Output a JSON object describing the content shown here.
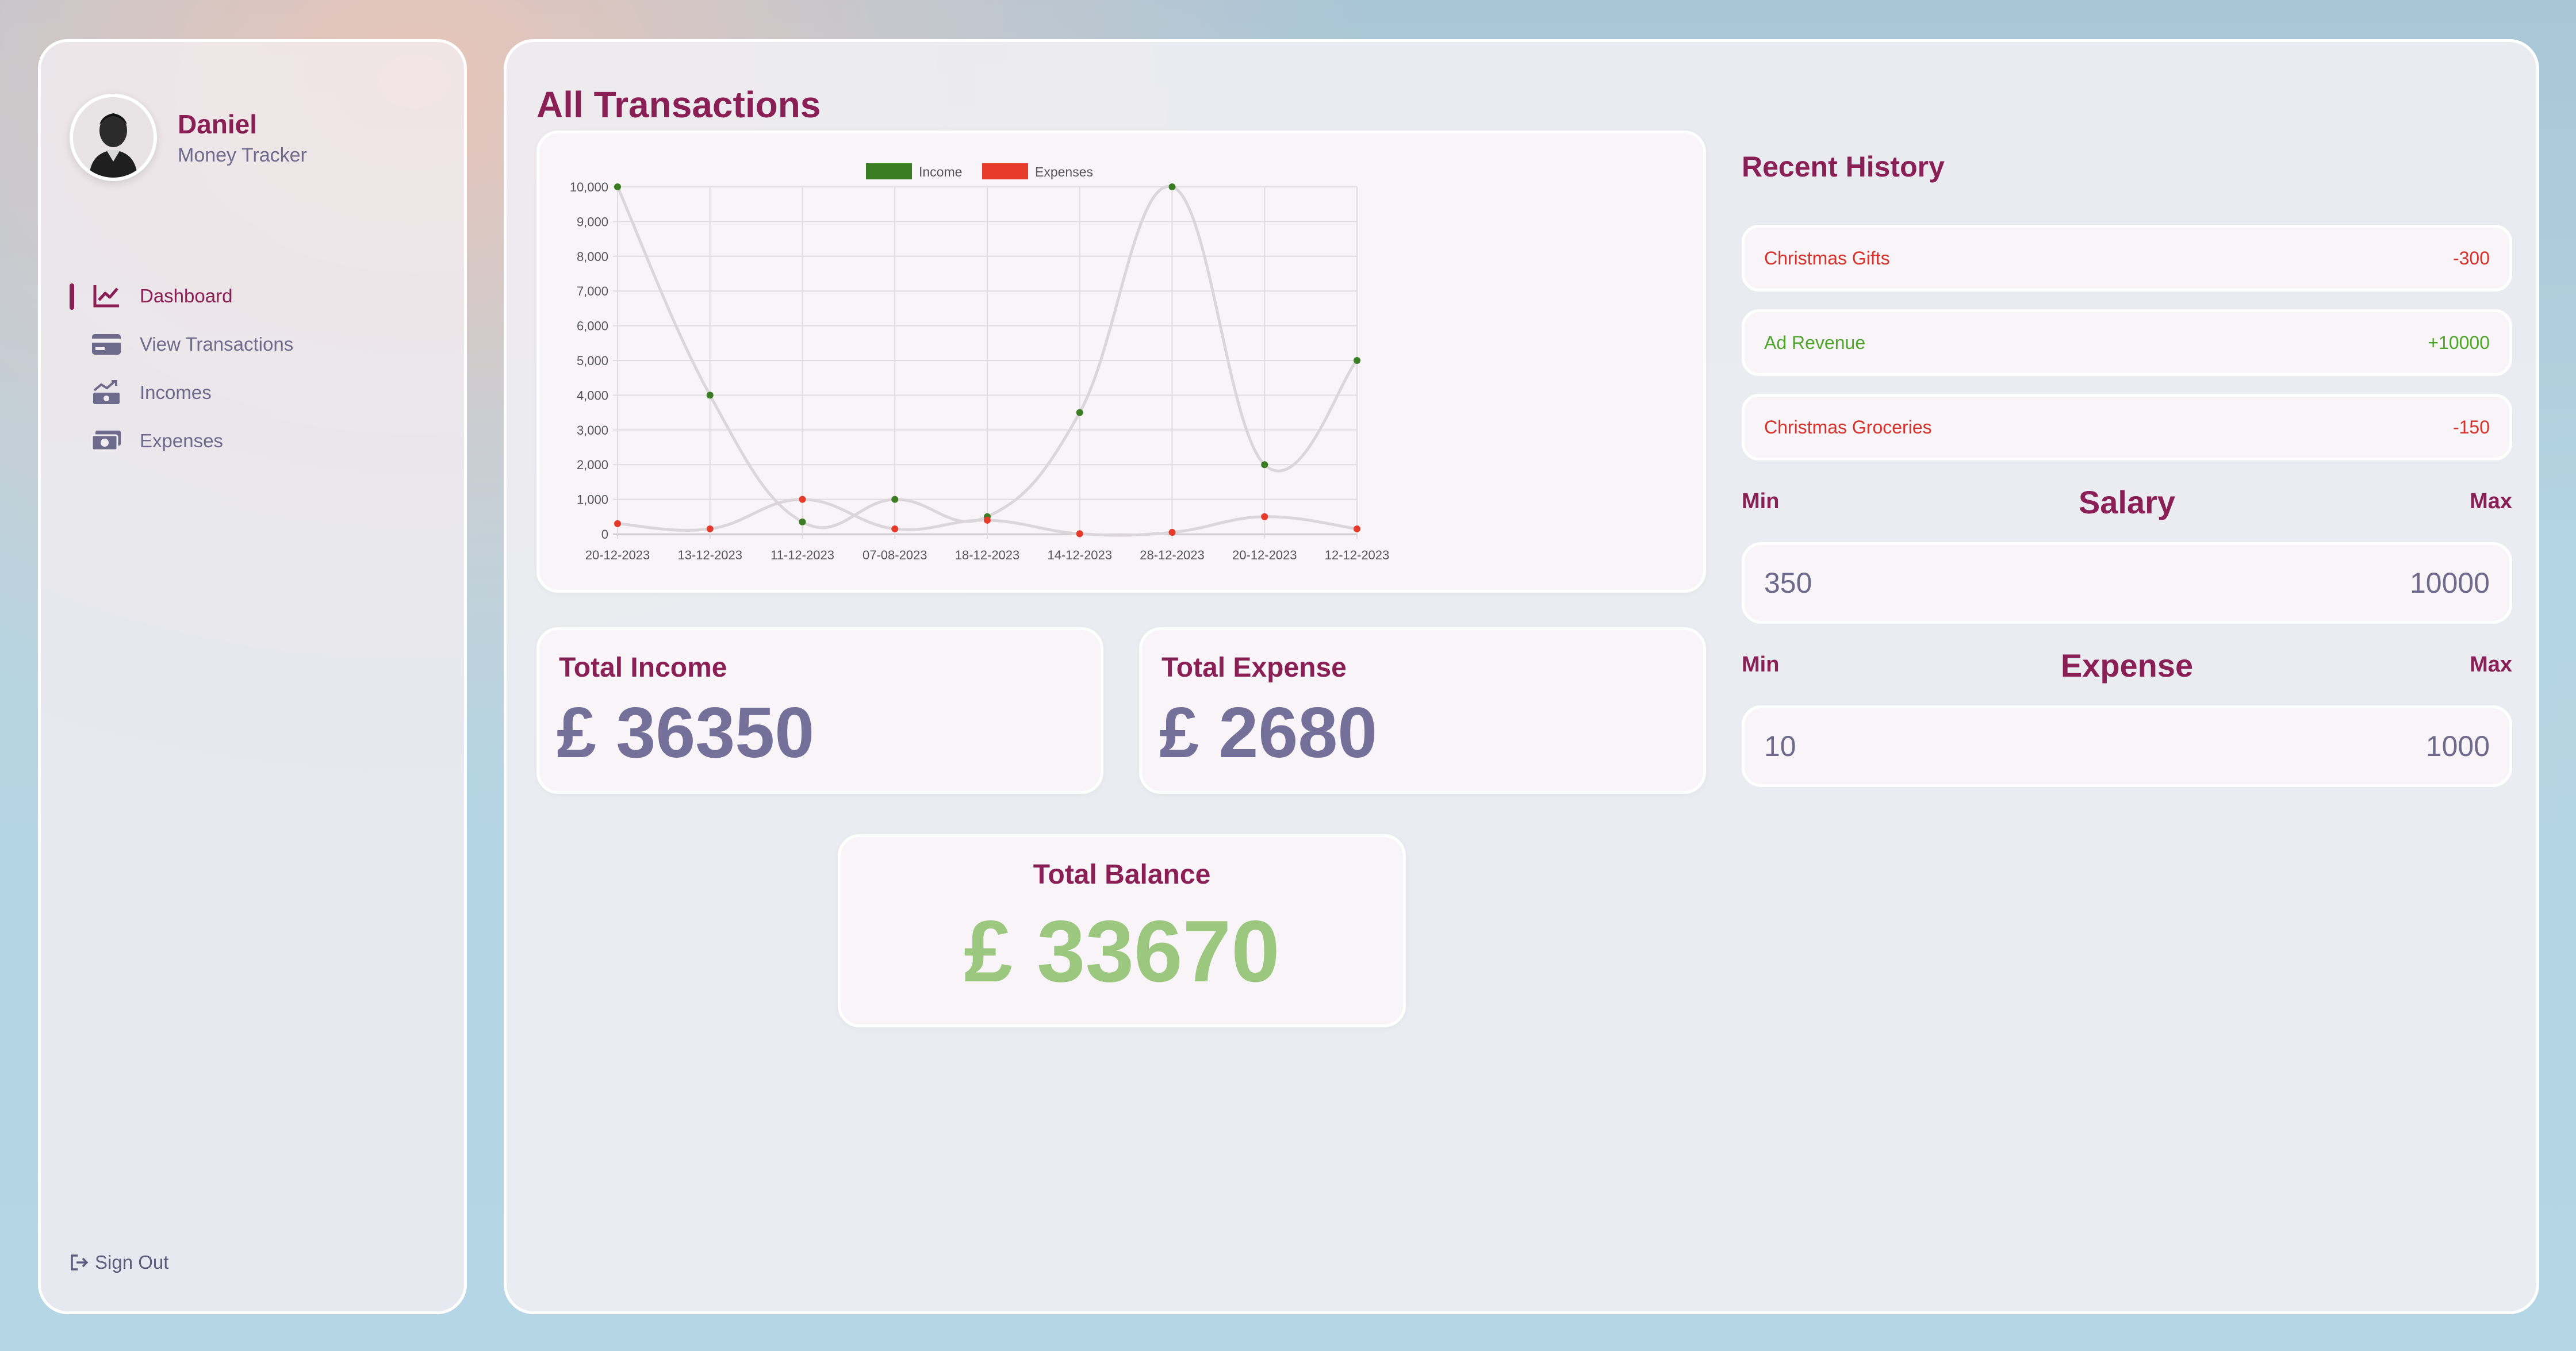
{
  "profile": {
    "name": "Daniel",
    "role": "Money Tracker"
  },
  "nav": [
    {
      "label": "Dashboard",
      "icon": "chart-line-icon",
      "active": true
    },
    {
      "label": "View Transactions",
      "icon": "credit-card-icon",
      "active": false
    },
    {
      "label": "Incomes",
      "icon": "money-trend-icon",
      "active": false
    },
    {
      "label": "Expenses",
      "icon": "money-bill-icon",
      "active": false
    }
  ],
  "signout": {
    "label": "Sign Out",
    "icon": "sign-out-icon"
  },
  "main": {
    "title": "All Transactions"
  },
  "chart_data": {
    "type": "line",
    "categories": [
      "20-12-2023",
      "13-12-2023",
      "11-12-2023",
      "07-08-2023",
      "18-12-2023",
      "14-12-2023",
      "28-12-2023",
      "20-12-2023",
      "12-12-2023"
    ],
    "series": [
      {
        "name": "Income",
        "color": "#3a7d22",
        "values": [
          10000,
          4000,
          350,
          1000,
          500,
          3500,
          10000,
          2000,
          5000
        ]
      },
      {
        "name": "Expenses",
        "color": "#e63a2a",
        "values": [
          300,
          150,
          1000,
          150,
          400,
          10,
          50,
          500,
          150
        ]
      }
    ],
    "ylim": [
      0,
      10000
    ],
    "yticks": [
      "0",
      "1,000",
      "2,000",
      "3,000",
      "4,000",
      "5,000",
      "6,000",
      "7,000",
      "8,000",
      "9,000",
      "10,000"
    ],
    "legend": "top",
    "grid": true,
    "line_color": "#dcd6da"
  },
  "totals": {
    "income_label": "Total Income",
    "income_value": "£ 36350",
    "expense_label": "Total Expense",
    "expense_value": "£ 2680",
    "balance_label": "Total Balance",
    "balance_value": "£ 33670"
  },
  "history": {
    "title": "Recent History",
    "items": [
      {
        "name": "Christmas Gifts",
        "amount": "-300",
        "type": "expense"
      },
      {
        "name": "Ad Revenue",
        "amount": "+10000",
        "type": "income"
      },
      {
        "name": "Christmas Groceries",
        "amount": "-150",
        "type": "expense"
      }
    ]
  },
  "salary": {
    "title": "Salary",
    "min_label": "Min",
    "max_label": "Max",
    "min": "350",
    "max": "10000"
  },
  "expense_range": {
    "title": "Expense",
    "min_label": "Min",
    "max_label": "Max",
    "min": "10",
    "max": "1000"
  }
}
